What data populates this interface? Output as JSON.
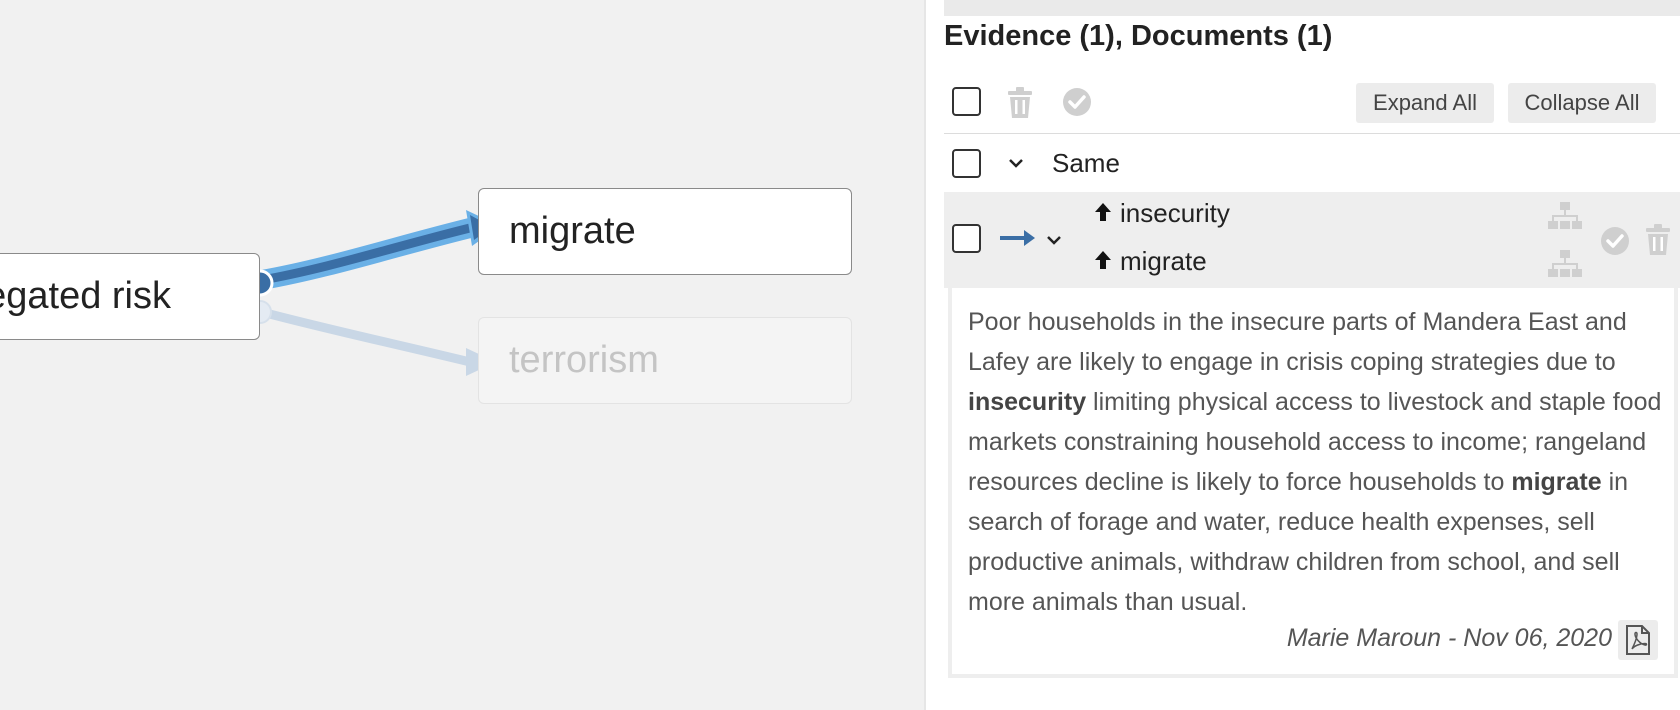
{
  "graph": {
    "source_node_label": "egated risk",
    "target_nodes": [
      {
        "label": "migrate",
        "state": "selected"
      },
      {
        "label": "terrorism",
        "state": "faded"
      }
    ],
    "edge_colors": {
      "selected_inner": "#3a6ea5",
      "selected_outer": "#6ab0e6",
      "faded": "#c9d7e6"
    }
  },
  "panel": {
    "title": "Evidence (1), Documents (1)",
    "toolbar": {
      "expand_all_label": "Expand All",
      "collapse_all_label": "Collapse All",
      "icons": [
        "select-all-checkbox",
        "trash-icon",
        "check-circle-icon"
      ]
    },
    "group": {
      "label": "Same",
      "icon": "chevron-down-icon"
    },
    "statement": {
      "subject": {
        "label": "insecurity",
        "polarity_icon": "arrow-up-icon"
      },
      "object": {
        "label": "migrate",
        "polarity_icon": "arrow-up-icon"
      },
      "relation_icon": "arrow-right-icon",
      "accent": "#3a6ea5"
    },
    "evidence": {
      "text_before_1": "Poor households in the insecure parts of Mandera East and Lafey are likely to engage in crisis coping strategies due to ",
      "highlight_1": "insecurity",
      "text_between": " limiting physical access to livestock and staple food markets constraining household access to income; rangeland resources decline is likely to force households to ",
      "highlight_2": "migrate",
      "text_after": " in search of forage and water, reduce health expenses, sell productive animals, withdraw children from school, and sell more animals than usual.",
      "meta": "Marie Maroun - Nov 06, 2020",
      "doc_icon": "pdf-icon"
    }
  }
}
